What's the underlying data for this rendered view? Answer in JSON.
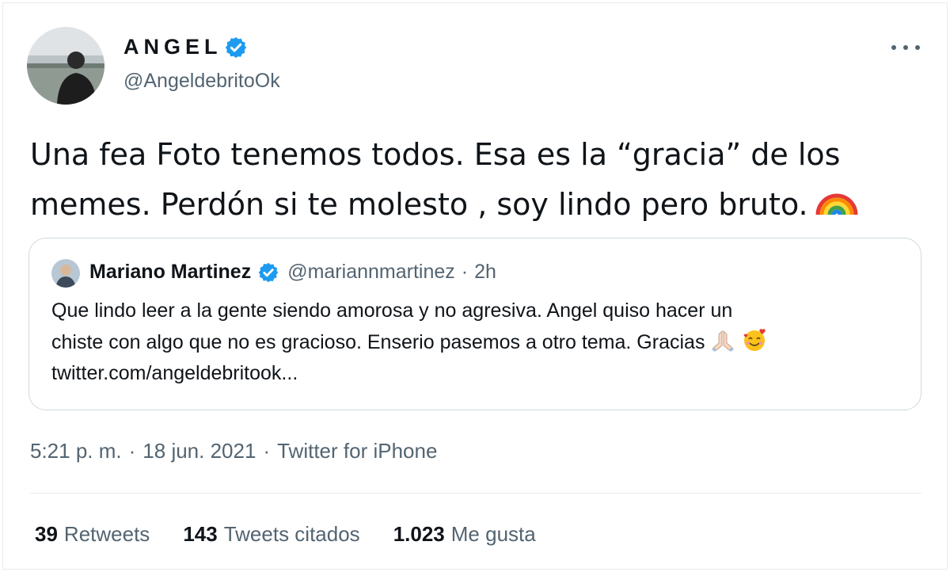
{
  "author": {
    "name": "ANGEL",
    "handle": "@AngeldebritoOk",
    "verified": true,
    "avatar": "avatar-photo"
  },
  "tweet": {
    "text_line1": "Una fea Foto tenemos todos. Esa es la “gracia” de los",
    "text_line2": "memes. Perdón si te molesto , soy lindo pero bruto.",
    "emoji": "rainbow-emoji"
  },
  "quoted_tweet": {
    "name": "Mariano Martinez",
    "handle": "@mariannmartinez",
    "separator": "·",
    "time": "2h",
    "verified": true,
    "text_line1": "Que lindo leer a la gente siendo amorosa y no agresiva. Angel quiso hacer un",
    "text_line2": "chiste con algo que no es gracioso. Enserio pasemos a otro tema. Gracias",
    "link": "twitter.com/angeldebritook...",
    "emojis": [
      "folded-hands-emoji",
      "smiling-face-with-hearts-emoji"
    ]
  },
  "meta": {
    "time": "5:21 p. m.",
    "separator": "·",
    "date": "18 jun. 2021",
    "source": "Twitter for iPhone"
  },
  "stats": [
    {
      "count": "39",
      "label": "Retweets"
    },
    {
      "count": "143",
      "label": "Tweets citados"
    },
    {
      "count": "1.023",
      "label": "Me gusta"
    }
  ],
  "colors": {
    "verified_blue": "#1d9bf0",
    "secondary_text": "#536471",
    "primary_text": "#0f1419",
    "border": "#cfd9de"
  },
  "icons": {
    "more": "more-horizontal-icon",
    "verified": "verified-badge-icon"
  }
}
